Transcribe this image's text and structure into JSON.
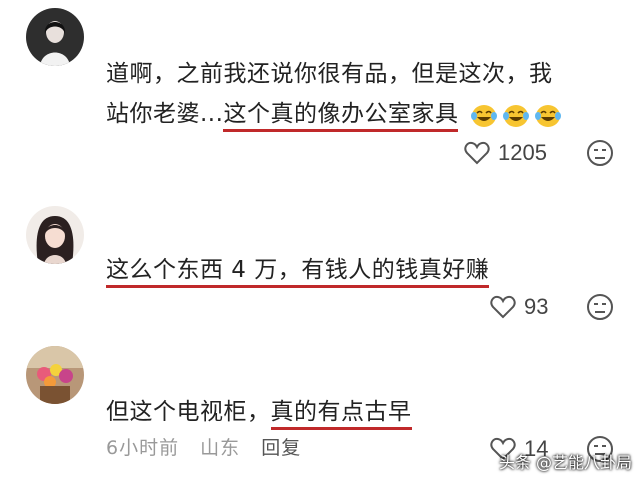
{
  "comments": [
    {
      "line1": "道啊，之前我还说你很有品，但是这次，我",
      "line2_plain": "站你老婆...",
      "line2_highlight": "这个真的像办公室家具",
      "emoji_icon": "laughing-tears-emoji",
      "likes": "1205"
    },
    {
      "highlight": "这么个东西 4 万，有钱人的钱真好赚",
      "likes": "93"
    },
    {
      "plain": "但这个电视柜，",
      "highlight": "真的有点古早",
      "time": "6小时前",
      "location": "山东",
      "reply_label": "回复",
      "likes": "14"
    }
  ],
  "watermark": "头条 @艺能八卦局",
  "colors": {
    "underline": "#c0292a",
    "meta": "#999999"
  }
}
